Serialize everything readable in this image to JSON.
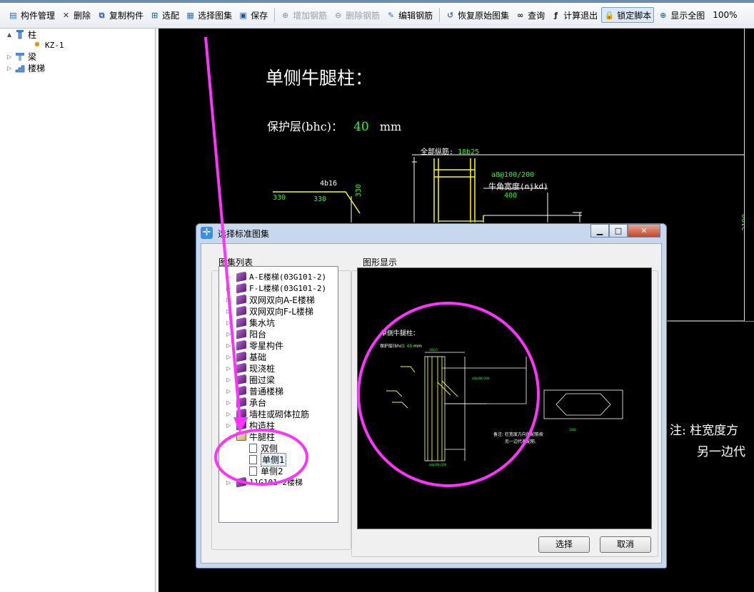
{
  "toolbar": {
    "items": [
      {
        "label": "构件管理",
        "icon": "list-window-icon",
        "state": "normal"
      },
      {
        "label": "删除",
        "icon": "delete-x-icon",
        "state": "normal"
      },
      {
        "label": "复制构件",
        "icon": "copy-icon",
        "state": "normal"
      },
      {
        "label": "选配",
        "icon": "select-match-icon",
        "state": "normal"
      },
      {
        "label": "选择图集",
        "icon": "atlas-icon",
        "state": "normal"
      },
      {
        "label": "保存",
        "icon": "save-disk-icon",
        "state": "normal"
      },
      {
        "label": "增加钢筋",
        "icon": "add-rebar-icon",
        "state": "disabled"
      },
      {
        "label": "删除钢筋",
        "icon": "delete-rebar-icon",
        "state": "disabled"
      },
      {
        "label": "编辑钢筋",
        "icon": "edit-rebar-icon",
        "state": "normal"
      },
      {
        "label": "恢复原始图集",
        "icon": "restore-icon",
        "state": "normal"
      },
      {
        "label": "查询",
        "icon": "binoculars-icon",
        "state": "normal"
      },
      {
        "label": "计算退出",
        "icon": "fx-icon",
        "state": "normal"
      },
      {
        "label": "锁定脚本",
        "icon": "lock-icon",
        "state": "active"
      },
      {
        "label": "显示全图",
        "icon": "zoom-fit-icon",
        "state": "normal"
      }
    ],
    "zoom": "100%"
  },
  "tree": {
    "items": [
      {
        "label": "柱",
        "level": 0,
        "expander": "▲",
        "icon": "column-icon"
      },
      {
        "label": "KZ-1",
        "level": 1,
        "expander": "",
        "icon": "gear-icon"
      },
      {
        "label": "梁",
        "level": 0,
        "expander": "▷",
        "icon": "beam-icon"
      },
      {
        "label": "楼梯",
        "level": 0,
        "expander": "▷",
        "icon": "stair-icon"
      }
    ]
  },
  "canvas": {
    "title": "单侧牛腿柱：",
    "cover_label": "保护层(bhc)：",
    "cover_value": "40",
    "cover_unit": "mm",
    "all_rebar_label": "全部纵筋:",
    "all_rebar_value": "18b25",
    "label_4b16": "4b16",
    "dim_330a": "330",
    "dim_330b": "330",
    "dim_330c": "330",
    "stirrup": "a8@100/200",
    "corbel_width_label": "牛角宽度(njkd)",
    "dim_400": "400",
    "dim_2100": "2100",
    "note_line1": "注: 柱宽度方",
    "note_line2": "另一边代"
  },
  "dialog": {
    "title": "选择标准图集",
    "list_label": "图集列表",
    "preview_label": "图形显示",
    "list_items": [
      {
        "label": "A-E楼梯(03G101-2)",
        "type": "book",
        "expander": "▷"
      },
      {
        "label": "F-L楼梯(03G101-2)",
        "type": "book",
        "expander": "▷"
      },
      {
        "label": "双网双向A-E楼梯",
        "type": "book",
        "expander": "▷"
      },
      {
        "label": "双网双向F-L楼梯",
        "type": "book",
        "expander": "▷"
      },
      {
        "label": "集水坑",
        "type": "book",
        "expander": "▷"
      },
      {
        "label": "阳台",
        "type": "book",
        "expander": "▷"
      },
      {
        "label": "零星构件",
        "type": "book",
        "expander": "▷"
      },
      {
        "label": "基础",
        "type": "book",
        "expander": "▷"
      },
      {
        "label": "现浇桩",
        "type": "book",
        "expander": "▷"
      },
      {
        "label": "圈过梁",
        "type": "book",
        "expander": "▷"
      },
      {
        "label": "普通楼梯",
        "type": "book",
        "expander": "▷"
      },
      {
        "label": "承台",
        "type": "book",
        "expander": "▷"
      },
      {
        "label": "墙柱或砌体拉筋",
        "type": "book",
        "expander": "▷"
      },
      {
        "label": "构造柱",
        "type": "book",
        "expander": "▷"
      },
      {
        "label": "牛腿柱",
        "type": "book-open",
        "expander": "◢"
      },
      {
        "label": "双侧",
        "type": "doc",
        "expander": ""
      },
      {
        "label": "单侧1",
        "type": "doc",
        "expander": "",
        "selected": true
      },
      {
        "label": "单侧2",
        "type": "doc",
        "expander": ""
      },
      {
        "label": "11G101-2楼梯",
        "type": "book",
        "expander": "▷"
      }
    ],
    "preview": {
      "title": "单侧牛腿柱：",
      "cover": "保护层(bhc):",
      "cover_value": "40",
      "cover_unit": "mm",
      "note_a": "备注: 柱宽度方向的配筋按",
      "note_b": "另一边代表配筋."
    },
    "select_label": "选择",
    "cancel_label": "取消",
    "window_buttons": [
      "▁",
      "□",
      "✕"
    ]
  },
  "annotation_color": "#ff33ff"
}
